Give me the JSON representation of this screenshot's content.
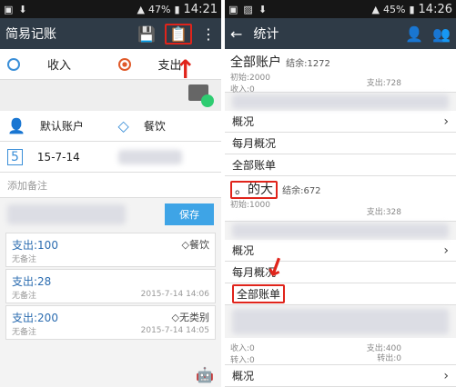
{
  "left": {
    "status": {
      "battery": "47%",
      "time": "14:21"
    },
    "app_title": "简易记账",
    "tabs": {
      "income": "收入",
      "expense": "支出"
    },
    "account": "默认账户",
    "category": "餐饮",
    "date": "15-7-14",
    "note_placeholder": "添加备注",
    "save_label": "保存",
    "records": [
      {
        "amount_label": "支出:100",
        "note": "无备注",
        "category": "餐饮",
        "date": ""
      },
      {
        "amount_label": "支出:28",
        "note": "无备注",
        "category": "",
        "date": "2015-7-14 14:06"
      },
      {
        "amount_label": "支出:200",
        "note": "无备注",
        "category": "无类别",
        "date": "2015-7-14 14:05"
      }
    ]
  },
  "right": {
    "status": {
      "battery": "45%",
      "time": "14:26"
    },
    "title": "统计",
    "all_account": {
      "name": "全部账户",
      "balance": "结余:1272",
      "init": "初始:2000",
      "income": "收入:0",
      "expense": "支出:728"
    },
    "menus": {
      "overview": "概况",
      "monthly": "每月概况",
      "all_bills": "全部账单"
    },
    "account2": {
      "name": "。的大",
      "balance": "结余:672",
      "init": "初始:1000",
      "expense": "支出:328"
    },
    "account3": {
      "income": "收入:0",
      "expense": "支出:400",
      "transfer_in": "转入:0",
      "transfer_out": "转出:0"
    }
  }
}
